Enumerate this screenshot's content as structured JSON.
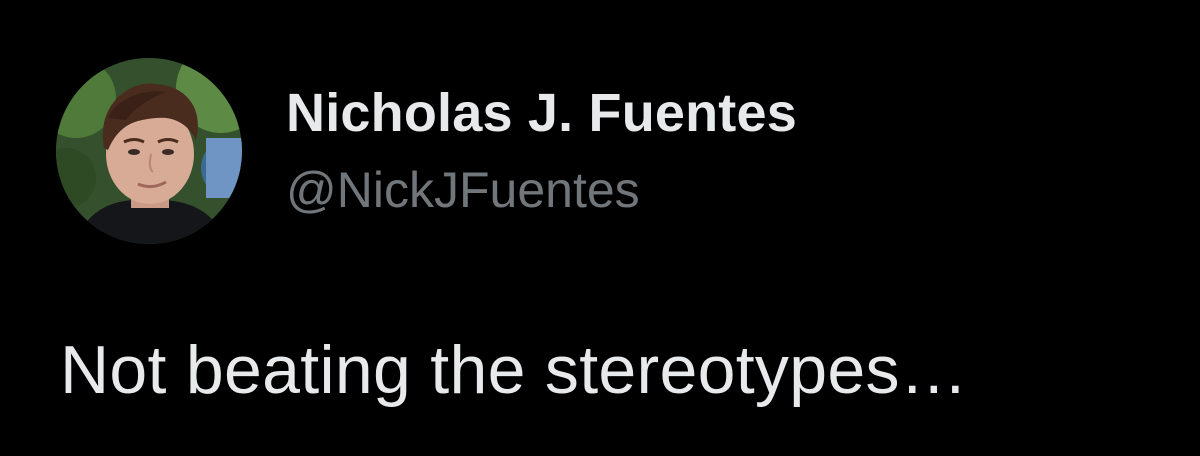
{
  "tweet": {
    "author": {
      "display_name": "Nicholas J. Fuentes",
      "handle": "@NickJFuentes",
      "avatar": "profile-photo"
    },
    "text": "Not beating the stereotypes…"
  },
  "colors": {
    "background": "#000000",
    "primary_text": "#e7e9ea",
    "secondary_text": "#71767b"
  }
}
